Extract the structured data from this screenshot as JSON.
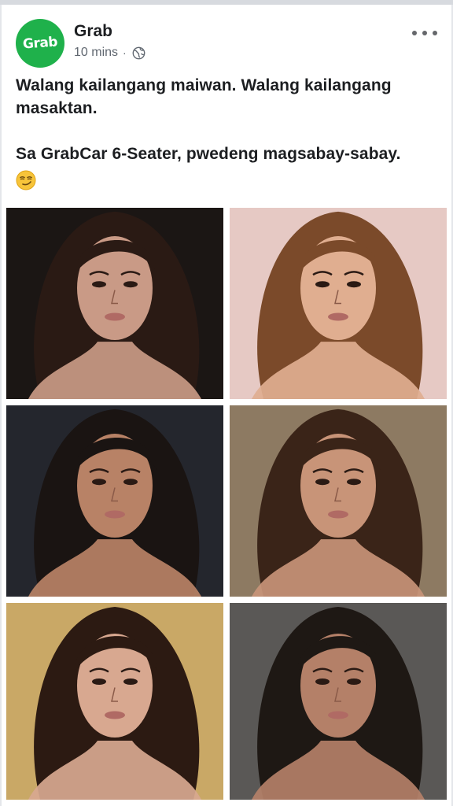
{
  "post": {
    "author": "Grab",
    "avatar_logo": "Grab",
    "time": "10 mins",
    "separator": "·",
    "privacy_icon": "globe-icon",
    "more_icon": "more-horizontal-icon",
    "text_line1": "Walang kailangang maiwan. Walang kailangang masaktan.",
    "text_line2": "Sa GrabCar 6-Seater, pwedeng magsabay-sabay.",
    "emoji": "smirking-face"
  },
  "photos": [
    {
      "name": "portrait-photo-1",
      "bg": "#1b1614",
      "hair": "#2a1a14",
      "skin": "#c99a86"
    },
    {
      "name": "portrait-photo-2",
      "bg": "#e6c9c4",
      "hair": "#7b4a2a",
      "skin": "#e0ae90"
    },
    {
      "name": "portrait-photo-3",
      "bg": "#24262d",
      "hair": "#1a1412",
      "skin": "#b88266"
    },
    {
      "name": "portrait-photo-4",
      "bg": "#8d7a62",
      "hair": "#3a2418",
      "skin": "#c89478"
    },
    {
      "name": "portrait-photo-5",
      "bg": "#c9a866",
      "hair": "#2c1a12",
      "skin": "#d8a890"
    },
    {
      "name": "portrait-photo-6",
      "bg": "#5a5856",
      "hair": "#1e1814",
      "skin": "#b48068"
    }
  ],
  "colors": {
    "brand_green": "#1fb14b",
    "text": "#1c1e21",
    "meta": "#606770"
  }
}
